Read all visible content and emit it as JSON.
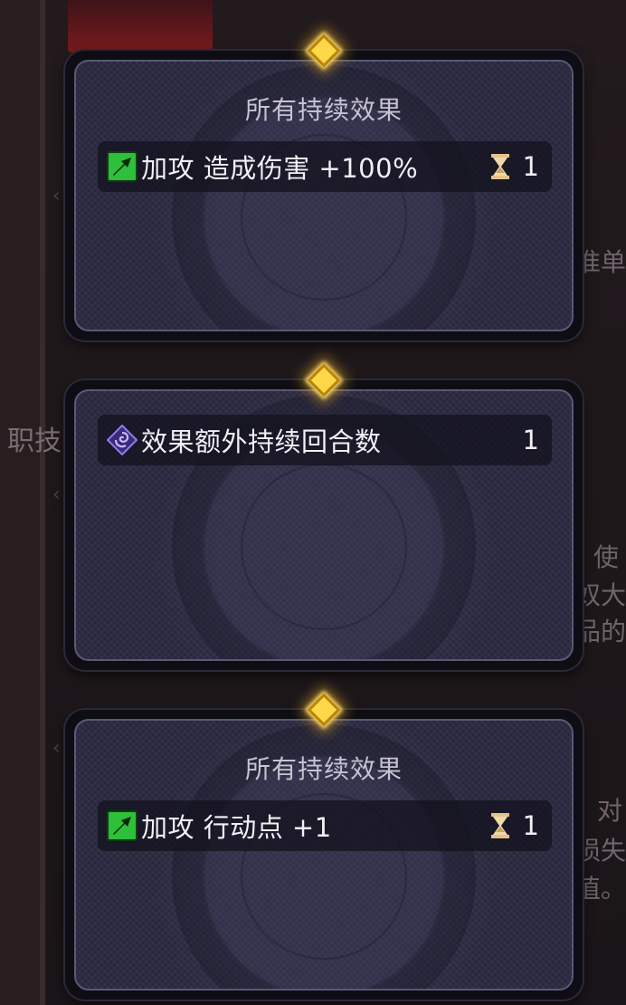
{
  "background": {
    "top_text": "",
    "side_text": "职技",
    "right_texts": [
      "准单",
      "使",
      "奴大",
      "品的",
      "对",
      "损失",
      "值。"
    ],
    "mid_text": ""
  },
  "cards": [
    {
      "title": "所有持续效果",
      "effects": [
        {
          "icon": "attack-up-icon",
          "text": "加攻 造成伤害 +100%",
          "duration_icon": "hourglass-icon",
          "value": "1"
        }
      ]
    },
    {
      "title": "",
      "effects": [
        {
          "icon": "purple-swirl-icon",
          "text": "效果额外持续回合数",
          "duration_icon": "",
          "value": "1"
        }
      ]
    },
    {
      "title": "所有持续效果",
      "effects": [
        {
          "icon": "attack-up-icon",
          "text": "加攻 行动点 +1",
          "duration_icon": "hourglass-icon",
          "value": "1"
        }
      ]
    }
  ],
  "colors": {
    "attack_icon_bg": "#2fbf3a",
    "swirl_icon": "#6b4fd6",
    "notch_gold": "#ffd84a",
    "card_fill": "#2c2b42"
  }
}
